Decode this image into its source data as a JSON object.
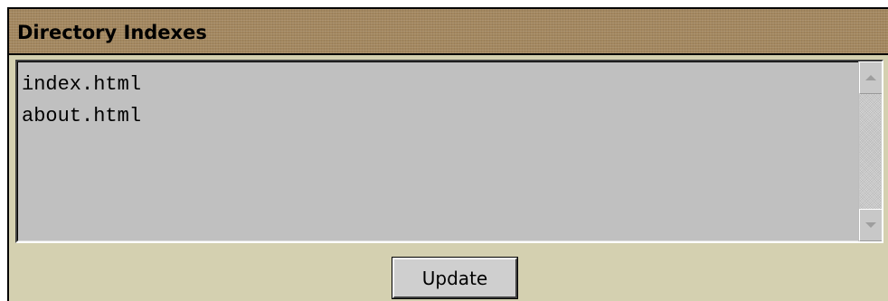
{
  "panel": {
    "title": "Directory Indexes"
  },
  "textarea": {
    "lines": [
      "index.html",
      "about.html"
    ]
  },
  "buttons": {
    "update_label": "Update"
  },
  "icons": {
    "scroll_up": "scroll-up-arrow-icon",
    "scroll_down": "scroll-down-arrow-icon"
  },
  "colors": {
    "titlebar": "#a3875f",
    "body_background": "#d4d0b0",
    "textarea_background": "#c0c0c0"
  }
}
